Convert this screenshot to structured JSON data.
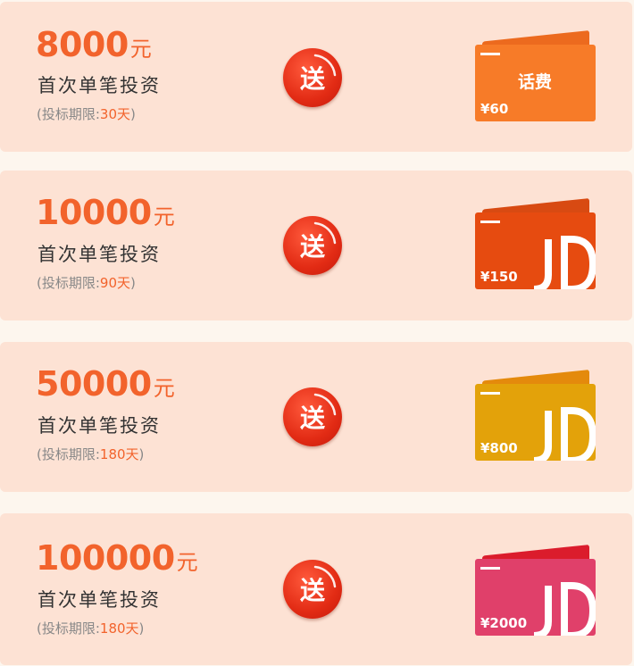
{
  "offers": [
    {
      "amount": "8000",
      "unit": "元",
      "description": "首次单笔投资",
      "term_prefix": "(投标期限:",
      "term_value": "30天",
      "term_suffix": ")",
      "badge": "送",
      "gift": {
        "label": "话费",
        "price": "¥60",
        "icon": "phone-credit-card-icon",
        "front_color": "#f77b28",
        "back_color": "#ec6a1e"
      }
    },
    {
      "amount": "10000",
      "unit": "元",
      "description": "首次单笔投资",
      "term_prefix": "(投标期限:",
      "term_value": "90天",
      "term_suffix": ")",
      "badge": "送",
      "gift": {
        "label": "JD",
        "price": "¥150",
        "icon": "jd-card-icon",
        "front_color": "#e64b10",
        "back_color": "#d84a12"
      }
    },
    {
      "amount": "50000",
      "unit": "元",
      "description": "首次单笔投资",
      "term_prefix": "(投标期限:",
      "term_value": "180天",
      "term_suffix": ")",
      "badge": "送",
      "gift": {
        "label": "JD",
        "price": "¥800",
        "icon": "jd-card-icon",
        "front_color": "#e3a20a",
        "back_color": "#e48a0c"
      }
    },
    {
      "amount": "100000",
      "unit": "元",
      "description": "首次单笔投资",
      "term_prefix": "(投标期限:",
      "term_value": "180天",
      "term_suffix": ")",
      "badge": "送",
      "gift": {
        "label": "JD",
        "price": "¥2000",
        "icon": "jd-card-icon",
        "front_color": "#e0406a",
        "back_color": "#db1c2c"
      }
    }
  ]
}
